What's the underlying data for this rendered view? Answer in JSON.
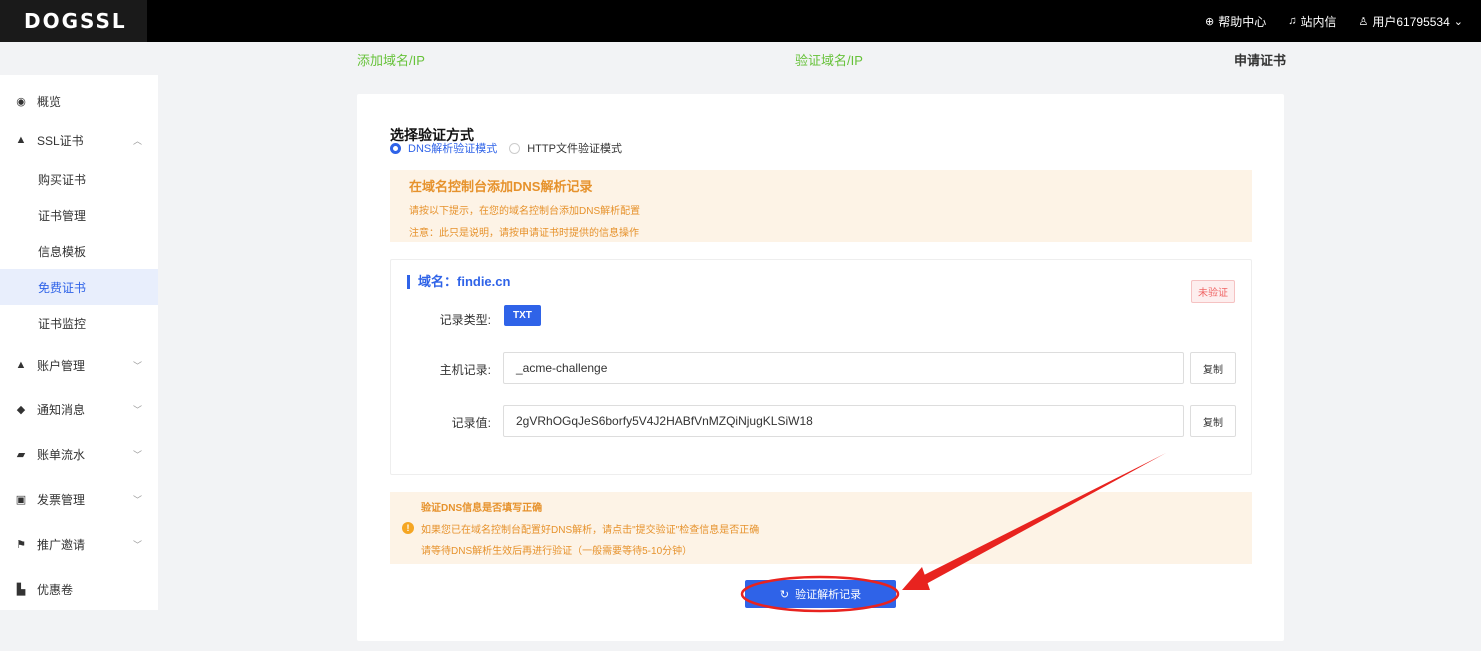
{
  "header": {
    "logo": "DOGSSL",
    "help": "帮助中心",
    "inbox": "站内信",
    "user": "用户61795534"
  },
  "sidebar": {
    "items": [
      {
        "label": "概览",
        "icon": "dashboard-icon"
      },
      {
        "label": "SSL证书",
        "icon": "user-icon",
        "expanded": true
      },
      {
        "label": "账户管理",
        "icon": "user-icon"
      },
      {
        "label": "通知消息",
        "icon": "bell-icon"
      },
      {
        "label": "账单流水",
        "icon": "bill-icon"
      },
      {
        "label": "发票管理",
        "icon": "invoice-icon"
      },
      {
        "label": "推广邀请",
        "icon": "flag-icon"
      },
      {
        "label": "优惠卷",
        "icon": "coupon-icon"
      }
    ],
    "ssl_sub": [
      "购买证书",
      "证书管理",
      "信息模板",
      "免费证书",
      "证书监控"
    ],
    "active_sub": "免费证书"
  },
  "steps": {
    "s1": "添加域名/IP",
    "s2": "验证域名/IP",
    "s3": "申请证书"
  },
  "main": {
    "section_title": "选择验证方式",
    "method_dns": "DNS解析验证模式",
    "method_http": "HTTP文件验证模式",
    "notice": {
      "title": "在域名控制台添加DNS解析记录",
      "line1": "请按以下提示，在您的域名控制台添加DNS解析配置",
      "line2": "注意：此只是说明，请按申请证书时提供的信息操作"
    },
    "domain": {
      "title": "域名：findie.cn",
      "status": "未验证",
      "type_label": "记录类型:",
      "type_value": "TXT",
      "host_label": "主机记录:",
      "host_value": "_acme-challenge",
      "value_label": "记录值:",
      "value_value": "2gVRhOGqJeS6borfy5V4J2HABfVnMZQiNjugKLSiW18",
      "copy": "复制"
    },
    "verify": {
      "title": "验证DNS信息是否填写正确",
      "line1": "如果您已在域名控制台配置好DNS解析，请点击\"提交验证\"检查信息是否正确",
      "line2": "请等待DNS解析生效后再进行验证（一般需要等待5-10分钟）"
    },
    "verify_button": "验证解析记录"
  },
  "colors": {
    "accent": "#2f63e8",
    "warning": "#e6922c",
    "annotation": "#e8231f",
    "step_done": "#67c23a"
  }
}
